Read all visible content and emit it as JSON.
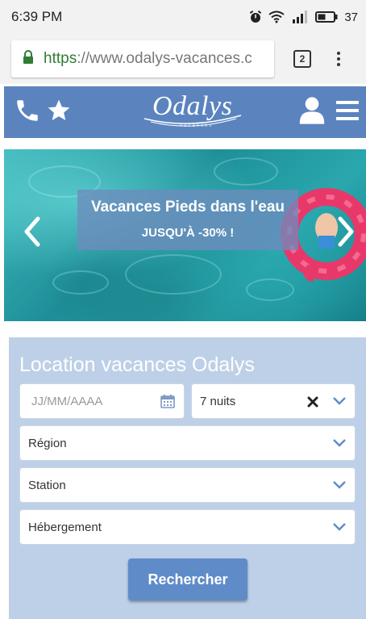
{
  "status_bar": {
    "time": "6:39 PM",
    "battery": "37",
    "icons": [
      "alarm-icon",
      "wifi-icon",
      "signal-icon",
      "battery-icon"
    ]
  },
  "browser": {
    "url_scheme": "https",
    "url_rest": "://www.odalys-vacances.c",
    "tab_count": "2",
    "icons": [
      "lock-icon",
      "overflow-menu-icon"
    ]
  },
  "header": {
    "logo_text": "Odalys",
    "logo_subtext": "vacances",
    "icons": [
      "phone-icon",
      "star-icon",
      "user-icon",
      "hamburger-menu-icon"
    ],
    "background": "#5b84bf"
  },
  "hero": {
    "title": "Vacances Pieds dans l'eau",
    "promo": "JUSQU'À -30% !"
  },
  "search": {
    "title": "Location vacances Odalys",
    "date_placeholder": "JJ/MM/AAAA",
    "nights_value": "7 nuits",
    "region_label": "Région",
    "station_label": "Station",
    "hebergement_label": "Hébergement",
    "submit_label": "Rechercher",
    "panel_color": "#bed0e7",
    "button_color": "#5f8cc9"
  }
}
